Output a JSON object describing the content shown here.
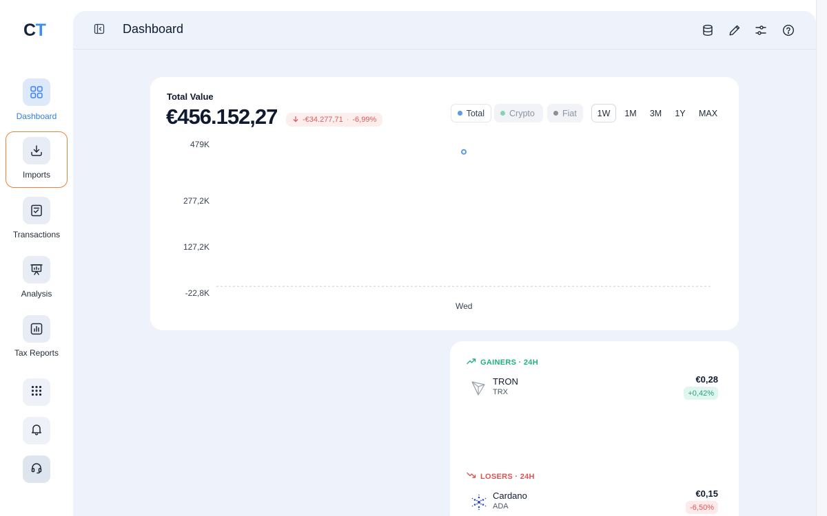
{
  "logo": {
    "c": "C",
    "t": "T"
  },
  "sidebar": {
    "items": [
      {
        "label": "Dashboard",
        "icon": "grid-icon",
        "active": true
      },
      {
        "label": "Imports",
        "icon": "download-icon",
        "focused": true
      },
      {
        "label": "Transactions",
        "icon": "checklist-icon"
      },
      {
        "label": "Analysis",
        "icon": "presentation-chart-icon"
      },
      {
        "label": "Tax Reports",
        "icon": "bar-report-icon"
      }
    ],
    "utility": [
      "apps-grid-icon",
      "bell-icon",
      "headset-icon"
    ]
  },
  "header": {
    "title": "Dashboard",
    "actions": [
      "database-icon",
      "pencil-icon",
      "sliders-icon",
      "help-icon"
    ]
  },
  "total_value": {
    "label": "Total Value",
    "amount": "€456.152,27",
    "change_amount": "-€34.277,71",
    "change_separator": "·",
    "change_percent": "-6,99%",
    "legend": [
      "Total",
      "Crypto",
      "Fiat"
    ],
    "ranges": [
      "1W",
      "1M",
      "3M",
      "1Y",
      "MAX"
    ],
    "active_range": "1W",
    "colors": {
      "total": "#5b9be8",
      "crypto": "#86d3b2",
      "fiat": "#8a8f98",
      "negative": "#e05a5a"
    }
  },
  "chart_data": {
    "type": "line",
    "y_ticks": [
      "479K",
      "277,2K",
      "127,2K",
      "-22,8K"
    ],
    "x_ticks": [
      "Wed"
    ],
    "ylim": [
      -22800,
      479000
    ],
    "series": [
      {
        "name": "Total",
        "x": [
          "Wed"
        ],
        "values": [
          456152.27
        ]
      }
    ],
    "baseline": 0
  },
  "movers": {
    "gainers": {
      "title": "GAINERS · 24H",
      "items": [
        {
          "name": "TRON",
          "symbol": "TRX",
          "price": "€0,28",
          "change": "+0,42%",
          "icon": "tron-icon"
        }
      ]
    },
    "losers": {
      "title": "LOSERS · 24H",
      "items": [
        {
          "name": "Cardano",
          "symbol": "ADA",
          "price": "€0,15",
          "change": "-6,50%",
          "icon": "cardano-icon"
        }
      ]
    }
  }
}
